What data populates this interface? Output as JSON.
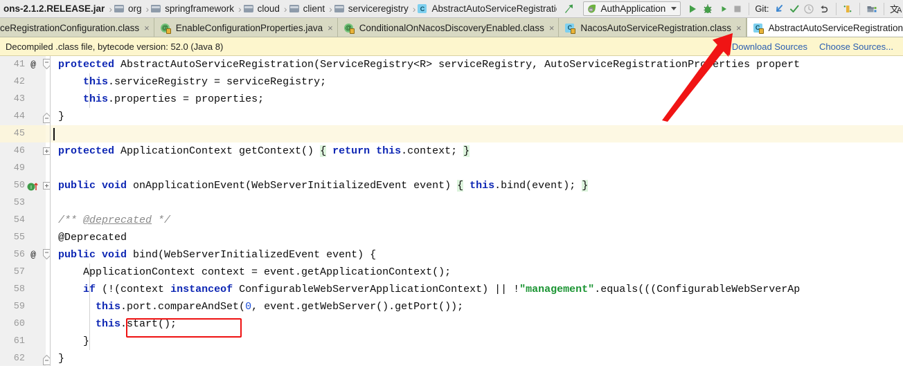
{
  "navbar": {
    "crumbs": [
      {
        "label": "ons-2.1.2.RELEASE.jar",
        "icon": "jar-icon",
        "bold": true
      },
      {
        "label": "org",
        "icon": "folder-icon",
        "bold": false
      },
      {
        "label": "springframework",
        "icon": "folder-icon",
        "bold": false
      },
      {
        "label": "cloud",
        "icon": "folder-icon",
        "bold": false
      },
      {
        "label": "client",
        "icon": "folder-icon",
        "bold": false
      },
      {
        "label": "serviceregistry",
        "icon": "folder-icon",
        "bold": false
      },
      {
        "label": "AbstractAutoServiceRegistration",
        "icon": "class-icon",
        "bold": false
      }
    ],
    "separator": "›",
    "run_config": {
      "label": "AuthApplication",
      "icon": "spring-leaf-icon"
    },
    "toolbar": {
      "run": "run-icon",
      "debug": "debug-icon",
      "profile": "run-with-coverage-icon",
      "stop": "stop-icon",
      "git_label": "Git:",
      "update": "update-project-icon",
      "commit": "commit-icon",
      "history": "history-icon",
      "rollback": "rollback-icon",
      "bookmark": "bookmark-icon",
      "project_structure": "project-structure-icon",
      "translate": "translate-icon"
    },
    "back_arrow": "navigate-up-icon"
  },
  "tabs": {
    "items": [
      {
        "label": "ceRegistrationConfiguration.class",
        "icon": "class-icon",
        "active": false,
        "clipped": true
      },
      {
        "label": "EnableConfigurationProperties.java",
        "icon": "annotation-icon",
        "active": false,
        "clipped": false
      },
      {
        "label": "ConditionalOnNacosDiscoveryEnabled.class",
        "icon": "annotation-icon",
        "active": false,
        "clipped": false
      },
      {
        "label": "NacosAutoServiceRegistration.class",
        "icon": "class-icon",
        "active": false,
        "clipped": false
      },
      {
        "label": "AbstractAutoServiceRegistration.class",
        "icon": "class-icon",
        "active": true,
        "clipped": false
      }
    ],
    "close_glyph": "×",
    "overflow_label": "tab-list-icon"
  },
  "notice": {
    "text": "Decompiled .class file, bytecode version: 52.0 (Java 8)",
    "links": [
      "Download Sources",
      "Choose Sources..."
    ]
  },
  "editor": {
    "lines": [
      {
        "no": "41",
        "mark": "@",
        "fold": "cap-top",
        "indent": 0,
        "tokens": [
          {
            "t": "kw",
            "v": "protected"
          },
          {
            "t": "p",
            "v": " AbstractAutoServiceRegistration(ServiceRegistry<R> serviceRegistry, AutoServiceRegistrationProperties propert"
          }
        ]
      },
      {
        "no": "42",
        "mark": "",
        "fold": "",
        "indent": 0,
        "guide": 1,
        "tokens": [
          {
            "t": "p",
            "v": "    "
          },
          {
            "t": "kw",
            "v": "this"
          },
          {
            "t": "p",
            "v": ".serviceRegistry = serviceRegistry;"
          }
        ]
      },
      {
        "no": "43",
        "mark": "",
        "fold": "",
        "indent": 0,
        "guide": 1,
        "tokens": [
          {
            "t": "p",
            "v": "    "
          },
          {
            "t": "kw",
            "v": "this"
          },
          {
            "t": "p",
            "v": ".properties = properties;"
          }
        ]
      },
      {
        "no": "44",
        "mark": "",
        "fold": "cap-bot",
        "indent": 0,
        "tokens": [
          {
            "t": "p",
            "v": "}"
          }
        ]
      },
      {
        "no": "45",
        "mark": "",
        "fold": "",
        "indent": 0,
        "caret": true,
        "tokens": []
      },
      {
        "no": "46",
        "mark": "",
        "fold": "plus",
        "indent": 0,
        "tokens": [
          {
            "t": "kw",
            "v": "protected"
          },
          {
            "t": "p",
            "v": " ApplicationContext getContext() "
          },
          {
            "t": "hl",
            "v": "{"
          },
          {
            "t": "p",
            "v": " "
          },
          {
            "t": "kw",
            "v": "return"
          },
          {
            "t": "p",
            "v": " "
          },
          {
            "t": "kw",
            "v": "this"
          },
          {
            "t": "p",
            "v": ".context; "
          },
          {
            "t": "hl",
            "v": "}"
          }
        ]
      },
      {
        "no": "49",
        "mark": "",
        "fold": "",
        "indent": 0,
        "tokens": []
      },
      {
        "no": "50",
        "mark": "override",
        "fold": "plus",
        "indent": 0,
        "tokens": [
          {
            "t": "kw",
            "v": "public"
          },
          {
            "t": "p",
            "v": " "
          },
          {
            "t": "kw",
            "v": "void"
          },
          {
            "t": "p",
            "v": " onApplicationEvent(WebServerInitializedEvent event) "
          },
          {
            "t": "hl",
            "v": "{"
          },
          {
            "t": "p",
            "v": " "
          },
          {
            "t": "kw",
            "v": "this"
          },
          {
            "t": "p",
            "v": ".bind(event); "
          },
          {
            "t": "hl",
            "v": "}"
          }
        ]
      },
      {
        "no": "53",
        "mark": "",
        "fold": "",
        "indent": 0,
        "tokens": []
      },
      {
        "no": "54",
        "mark": "",
        "fold": "",
        "indent": 0,
        "tokens": [
          {
            "t": "cmt",
            "v": "/** "
          },
          {
            "t": "cmtu",
            "v": "@deprecated"
          },
          {
            "t": "cmt",
            "v": " */"
          }
        ]
      },
      {
        "no": "55",
        "mark": "",
        "fold": "",
        "indent": 0,
        "tokens": [
          {
            "t": "p",
            "v": "@Deprecated"
          }
        ]
      },
      {
        "no": "56",
        "mark": "@",
        "fold": "cap-top",
        "indent": 0,
        "tokens": [
          {
            "t": "kw",
            "v": "public"
          },
          {
            "t": "p",
            "v": " "
          },
          {
            "t": "kw",
            "v": "void"
          },
          {
            "t": "p",
            "v": " bind(WebServerInitializedEvent event) {"
          }
        ]
      },
      {
        "no": "57",
        "mark": "",
        "fold": "",
        "indent": 0,
        "guide": 1,
        "tokens": [
          {
            "t": "p",
            "v": "    ApplicationContext context = event.getApplicationContext();"
          }
        ]
      },
      {
        "no": "58",
        "mark": "",
        "fold": "",
        "indent": 0,
        "guide": 1,
        "tokens": [
          {
            "t": "p",
            "v": "    "
          },
          {
            "t": "kw",
            "v": "if"
          },
          {
            "t": "p",
            "v": " (!(context "
          },
          {
            "t": "kw",
            "v": "instanceof"
          },
          {
            "t": "p",
            "v": " ConfigurableWebServerApplicationContext) || !"
          },
          {
            "t": "str",
            "v": "\"management\""
          },
          {
            "t": "p",
            "v": ".equals(((ConfigurableWebServerAp"
          }
        ]
      },
      {
        "no": "59",
        "mark": "",
        "fold": "",
        "indent": 0,
        "guide": 2,
        "tokens": [
          {
            "t": "p",
            "v": "      "
          },
          {
            "t": "kw",
            "v": "this"
          },
          {
            "t": "p",
            "v": ".port.compareAndSet("
          },
          {
            "t": "num",
            "v": "0"
          },
          {
            "t": "p",
            "v": ", event.getWebServer().getPort());"
          }
        ]
      },
      {
        "no": "60",
        "mark": "",
        "fold": "",
        "indent": 0,
        "guide": 2,
        "tokens": [
          {
            "t": "p",
            "v": "      "
          },
          {
            "t": "kw",
            "v": "this"
          },
          {
            "t": "p",
            "v": ".start();"
          }
        ]
      },
      {
        "no": "61",
        "mark": "",
        "fold": "",
        "indent": 0,
        "guide": 1,
        "tokens": [
          {
            "t": "p",
            "v": "    }"
          }
        ]
      },
      {
        "no": "62",
        "mark": "",
        "fold": "cap-bot",
        "indent": 0,
        "tokens": [
          {
            "t": "p",
            "v": "}"
          }
        ]
      }
    ]
  },
  "annotations": {
    "highlight_box": {
      "target": "this.start();",
      "color": "#ee1111"
    },
    "pointer_arrow": {
      "target": "AbstractAutoServiceRegistration.class tab",
      "color": "#ee1111"
    }
  }
}
